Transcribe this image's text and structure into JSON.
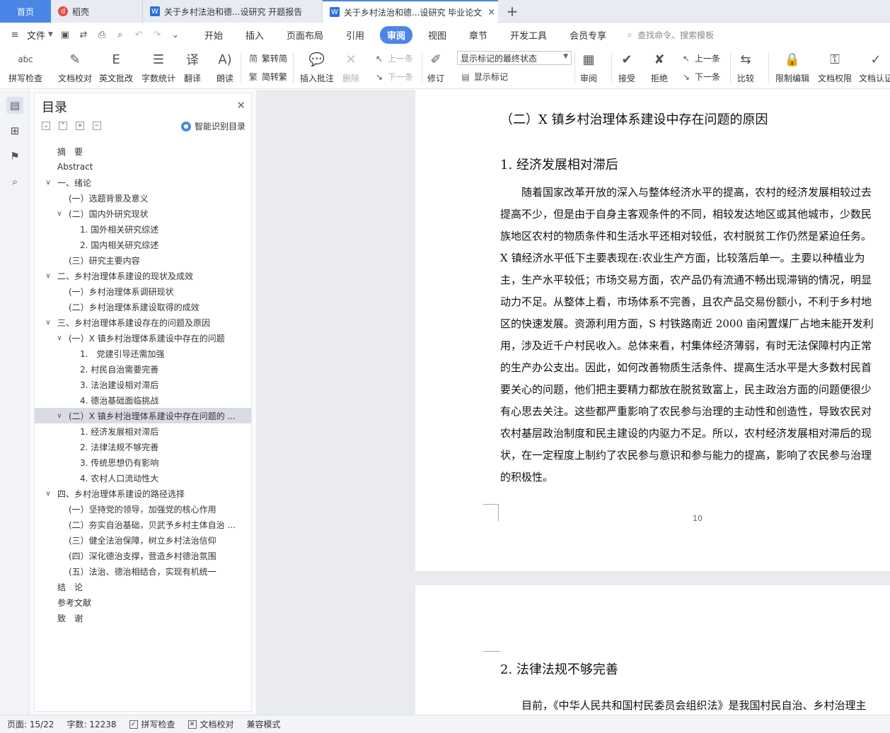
{
  "tabs": {
    "home": "首页",
    "daoke": "稻壳",
    "doc1": "关于乡村法治和德...设研究 开题报告",
    "doc2": "关于乡村法治和德...设研究 毕业论文",
    "add": "+"
  },
  "menu": {
    "file": "文件",
    "tabs": [
      "开始",
      "插入",
      "页面布局",
      "引用",
      "审阅",
      "视图",
      "章节",
      "开发工具",
      "会员专享"
    ],
    "search": "查找命令、搜索模板"
  },
  "ribbon": {
    "spellcheck": "拼写检查",
    "doccheck": "文档校对",
    "englishreview": "英文批改",
    "wordcount": "字数统计",
    "translate": "翻译",
    "read": "朗读",
    "trad": "繁转简",
    "simp": "简转繁",
    "insertcomment": "插入批注",
    "delete": "删除",
    "prev1": "上一条",
    "next1": "下一条",
    "revise": "修订",
    "markstate": "显示标记的最终状态",
    "showmark": "显示标记",
    "review": "审阅",
    "accept": "接受",
    "reject": "拒绝",
    "prev2": "上一条",
    "next2": "下一条",
    "compare": "比较",
    "restrict": "限制编辑",
    "docperm": "文档权限",
    "docauth": "文档认证"
  },
  "toc": {
    "title": "目录",
    "smart": "智能识别目录",
    "items": [
      {
        "text": "摘　要",
        "level": 0,
        "tw": ""
      },
      {
        "text": "Abstract",
        "level": 0,
        "tw": ""
      },
      {
        "text": "一、绪论",
        "level": 0,
        "tw": "∨"
      },
      {
        "text": "(一）选题背景及意义",
        "level": 1,
        "tw": ""
      },
      {
        "text": "(二）国内外研究现状",
        "level": 1,
        "tw": "∨"
      },
      {
        "text": "1. 国外相关研究综述",
        "level": 2,
        "tw": ""
      },
      {
        "text": "2. 国内相关研究综述",
        "level": 2,
        "tw": ""
      },
      {
        "text": "(三）研究主要内容",
        "level": 1,
        "tw": ""
      },
      {
        "text": "二、乡村治理体系建设的现状及成效",
        "level": 0,
        "tw": "∨"
      },
      {
        "text": "(一）乡村治理体系调研现状",
        "level": 1,
        "tw": ""
      },
      {
        "text": "(二）乡村治理体系建设取得的成效",
        "level": 1,
        "tw": ""
      },
      {
        "text": "三、乡村治理体系建设存在的问题及原因",
        "level": 0,
        "tw": "∨"
      },
      {
        "text": "(一）X 镇乡村治理体系建设中存在的问题",
        "level": 1,
        "tw": "∨"
      },
      {
        "text": "1.　党建引导还需加强",
        "level": 2,
        "tw": ""
      },
      {
        "text": "2. 村民自治需要完善",
        "level": 2,
        "tw": ""
      },
      {
        "text": "3. 法治建设相对滞后",
        "level": 2,
        "tw": ""
      },
      {
        "text": "4. 德治基础面临挑战",
        "level": 2,
        "tw": ""
      },
      {
        "text": "(二）X 镇乡村治理体系建设中存在问题的 ...",
        "level": 1,
        "tw": "∨",
        "sel": true
      },
      {
        "text": "1. 经济发展相对滞后",
        "level": 2,
        "tw": ""
      },
      {
        "text": "2. 法律法规不够完善",
        "level": 2,
        "tw": ""
      },
      {
        "text": "3. 传统思想仍有影响",
        "level": 2,
        "tw": ""
      },
      {
        "text": "4. 农村人口流动性大",
        "level": 2,
        "tw": ""
      },
      {
        "text": "四、乡村治理体系建设的路径选择",
        "level": 0,
        "tw": "∨"
      },
      {
        "text": "(一）坚持党的领导，加强党的核心作用",
        "level": 1,
        "tw": ""
      },
      {
        "text": "(二）夯实自治基础，贝武予乡村主体自治 ...",
        "level": 1,
        "tw": ""
      },
      {
        "text": "(三）健全法治保障，树立乡村法治信仰",
        "level": 1,
        "tw": ""
      },
      {
        "text": "(四）深化德治支撑，营造乡村德治氛围",
        "level": 1,
        "tw": ""
      },
      {
        "text": "(五）法治、德治相结合，实现有机统一",
        "level": 1,
        "tw": ""
      },
      {
        "text": "结　论",
        "level": 0,
        "tw": ""
      },
      {
        "text": "参考文献",
        "level": 0,
        "tw": ""
      },
      {
        "text": "致　谢",
        "level": 0,
        "tw": ""
      }
    ]
  },
  "doc": {
    "heading": "（二）X 镇乡村治理体系建设中存在问题的原因",
    "sub1": "1. 经济发展相对滞后",
    "lines": [
      "　　随着国家改革开放的深入与整体经济水平的提高，农村的经济发展相较过去",
      "提高不少，但是由于自身主客观条件的不同，相较发达地区或其他城市，少数民",
      "族地区农村的物质条件和生活水平还相对较低，农村脱贫工作仍然是紧迫任务。",
      "X 镇经济水平低下主要表现在:农业生产方面，比较落后单一。主要以种植业为",
      "主，生产水平较低；市场交易方面，农产品仍有流通不畅出现滞销的情况，明显",
      "动力不足。从整体上看，市场体系不完善，且农产品交易份额小，不利于乡村地",
      "区的快速发展。资源利用方面，S 村铁路南近 2000 亩闲置煤厂占地未能开发利",
      "用，涉及近千户村民收入。总体来看，村集体经济薄弱，有时无法保障村内正常",
      "的生产办公支出。因此，如何改善物质生活条件、提高生活水平是大多数村民首",
      "要关心的问题，他们把主要精力都放在脱贫致富上，民主政治方面的问题便很少",
      "有心思去关注。这些都严重影响了农民参与治理的主动性和创造性，导致农民对",
      "农村基层政治制度和民主建设的内驱力不足。所以，农村经济发展相对滞后的现",
      "状，在一定程度上制约了农民参与意识和参与能力的提高，影响了农民参与治理",
      "的积极性。"
    ],
    "page_number": "10",
    "sub2": "2. 法律法规不够完善",
    "p2line": "　　目前，《中华人民共和国村民委员会组织法》是我国村民自治、乡村治理主"
  },
  "status": {
    "page": "页面: 15/22",
    "words": "字数: 12238",
    "spell": "拼写检查",
    "proof": "文档校对",
    "compat": "兼容模式"
  },
  "colors": {
    "accent": "#4a86e8",
    "selected_toc": "#d9dde3"
  }
}
